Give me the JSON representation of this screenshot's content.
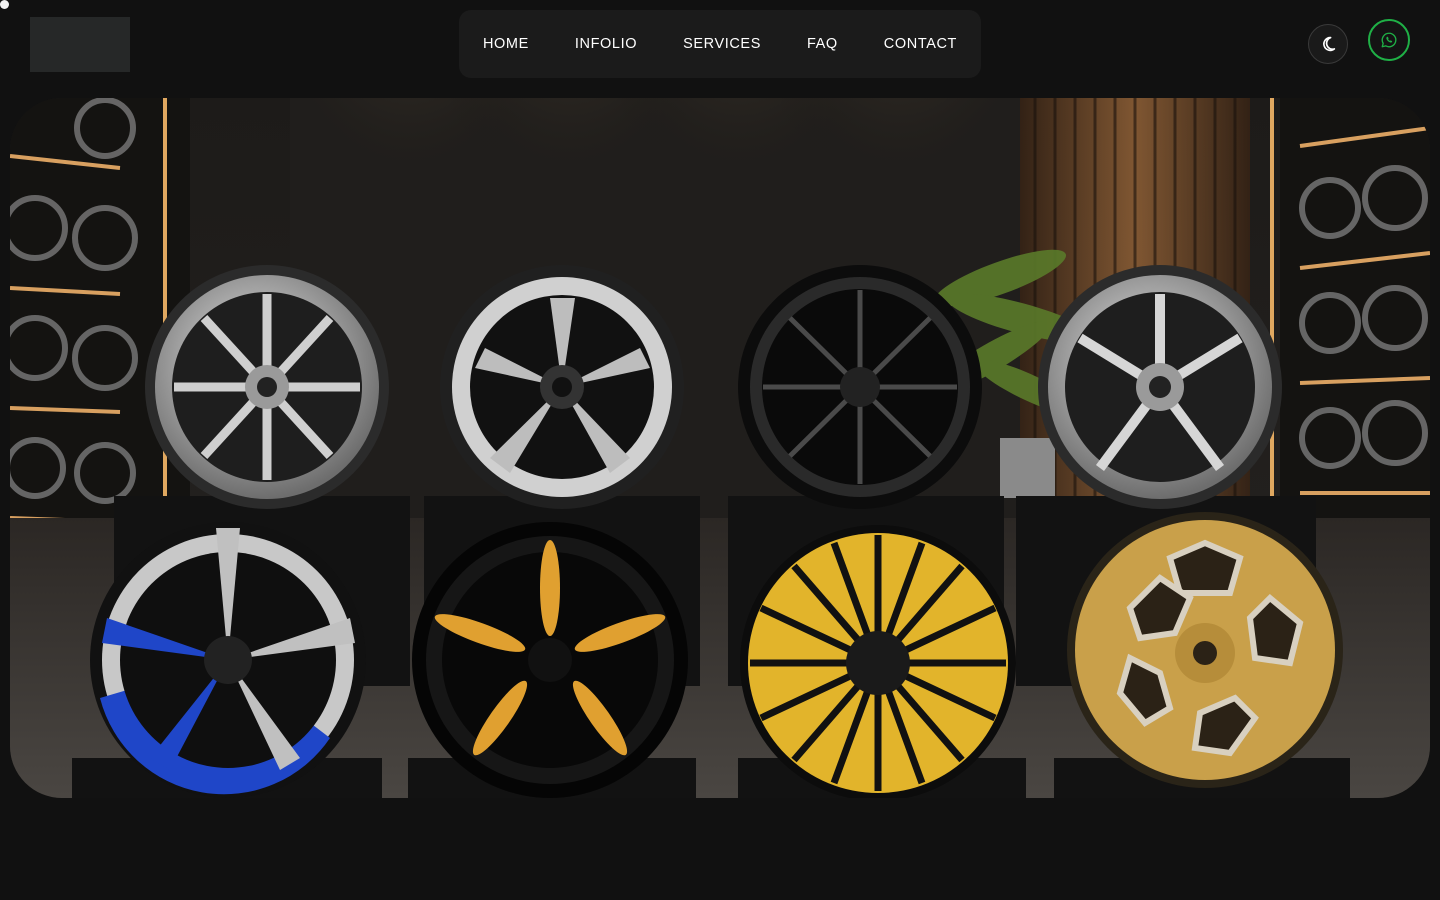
{
  "header": {
    "logo_alt": "",
    "nav": [
      {
        "label": "HOME"
      },
      {
        "label": "INFOLIO"
      },
      {
        "label": "SERVICES"
      },
      {
        "label": "FAQ"
      },
      {
        "label": "CONTACT"
      }
    ],
    "theme_icon": "moon-icon",
    "whatsapp_icon": "whatsapp-icon"
  },
  "colors": {
    "background": "#111111",
    "nav_background": "#1b1b1b",
    "whatsapp_ring": "#1fb046",
    "wheel_yellow": "#e2b42b",
    "wheel_gold": "#c9a04a",
    "wheel_blue": "#1f46c8"
  },
  "hero": {
    "image_subject": "showroom-of-alloy-wheels"
  }
}
